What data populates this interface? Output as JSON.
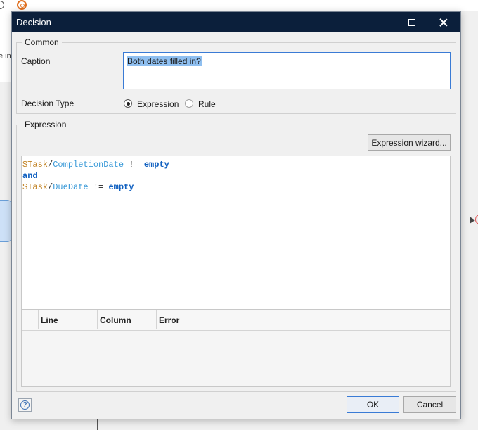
{
  "dialog": {
    "title": "Decision"
  },
  "background": {
    "left_text": "e in"
  },
  "common": {
    "legend": "Common",
    "caption_label": "Caption",
    "caption_value": "Both dates filled in?",
    "decision_type_label": "Decision Type",
    "decision_type_options": [
      "Expression",
      "Rule"
    ],
    "decision_type_selected": "Expression"
  },
  "expression": {
    "legend": "Expression",
    "wizard_button": "Expression wizard...",
    "code": {
      "line1": {
        "var": "$Task",
        "slash": "/",
        "attr": "CompletionDate",
        "op": " != ",
        "kw": "empty"
      },
      "line2": {
        "kw": "and"
      },
      "line3": {
        "var": "$Task",
        "slash": "/",
        "attr": "DueDate",
        "op": " != ",
        "kw": "empty"
      }
    },
    "error_columns": [
      "Line",
      "Column",
      "Error"
    ]
  },
  "footer": {
    "help_glyph": "?",
    "ok_label": "OK",
    "cancel_label": "Cancel"
  },
  "colors": {
    "titlebar": "#0b1f3b",
    "variable": "#c08020",
    "attribute": "#3a9ad8",
    "keyword": "#1060c0",
    "selection": "#8fbff0"
  }
}
